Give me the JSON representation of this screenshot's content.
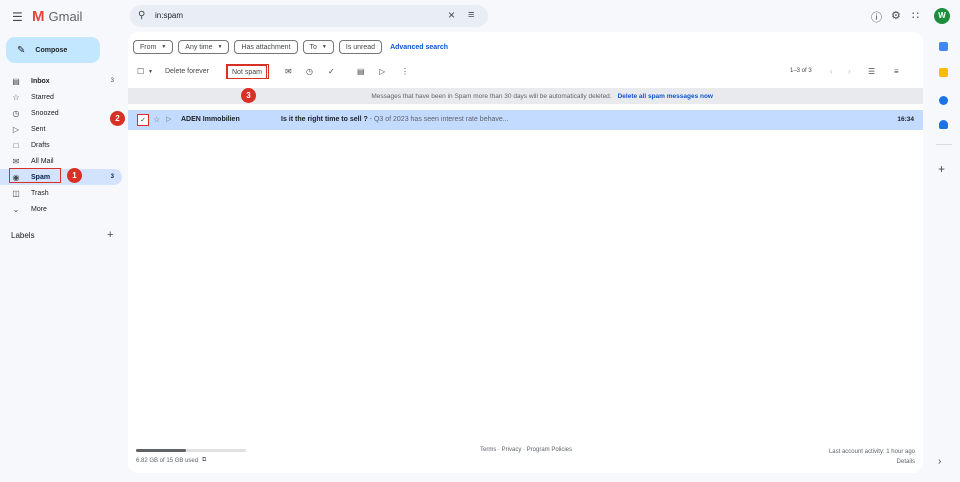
{
  "app": {
    "name": "Gmail",
    "logo_letter": "M",
    "avatar_letter": "W"
  },
  "search": {
    "query": "in:spam"
  },
  "compose": {
    "label": "Compose"
  },
  "nav": [
    {
      "icon": "inbox-icon",
      "label": "Inbox",
      "count": "3",
      "bold": true
    },
    {
      "icon": "star-icon",
      "label": "Starred",
      "count": ""
    },
    {
      "icon": "clock-icon",
      "label": "Snoozed",
      "count": ""
    },
    {
      "icon": "send-icon",
      "label": "Sent",
      "count": ""
    },
    {
      "icon": "file-icon",
      "label": "Drafts",
      "count": ""
    },
    {
      "icon": "all-mail-icon",
      "label": "All Mail",
      "count": ""
    },
    {
      "icon": "spam-icon",
      "label": "Spam",
      "count": "3",
      "active": true
    },
    {
      "icon": "trash-icon",
      "label": "Trash",
      "count": ""
    },
    {
      "icon": "chevron-down-icon",
      "label": "More",
      "count": ""
    }
  ],
  "labels": {
    "title": "Labels"
  },
  "filters": {
    "from": "From",
    "any_time": "Any time",
    "has_attachment": "Has attachment",
    "to": "To",
    "is_unread": "Is unread",
    "advanced": "Advanced search"
  },
  "toolbar": {
    "delete_forever": "Delete forever",
    "not_spam": "Not spam",
    "pagination": "1–3 of 3"
  },
  "banner": {
    "text": "Messages that have been in Spam more than 30 days will be automatically deleted.",
    "link": "Delete all spam messages now"
  },
  "emails": [
    {
      "sender": "ADEN Immobilien",
      "subject": "Is it the right time to sell ?",
      "snippet": " - Q3 of 2023 has seen interest rate behave...",
      "time": "16:34",
      "selected": true
    }
  ],
  "footer": {
    "storage": "6.82 GB of 15 GB used",
    "storage_used_fraction": 0.45,
    "links": "Terms · Privacy · Program Policies",
    "activity": "Last account activity: 1 hour ago",
    "details": "Details"
  },
  "annotations": [
    "1",
    "2",
    "3"
  ],
  "colors": {
    "accent": "#0b57d0",
    "selected_row": "#c2dbff",
    "marker": "#d93025",
    "compose": "#c2e7ff"
  }
}
